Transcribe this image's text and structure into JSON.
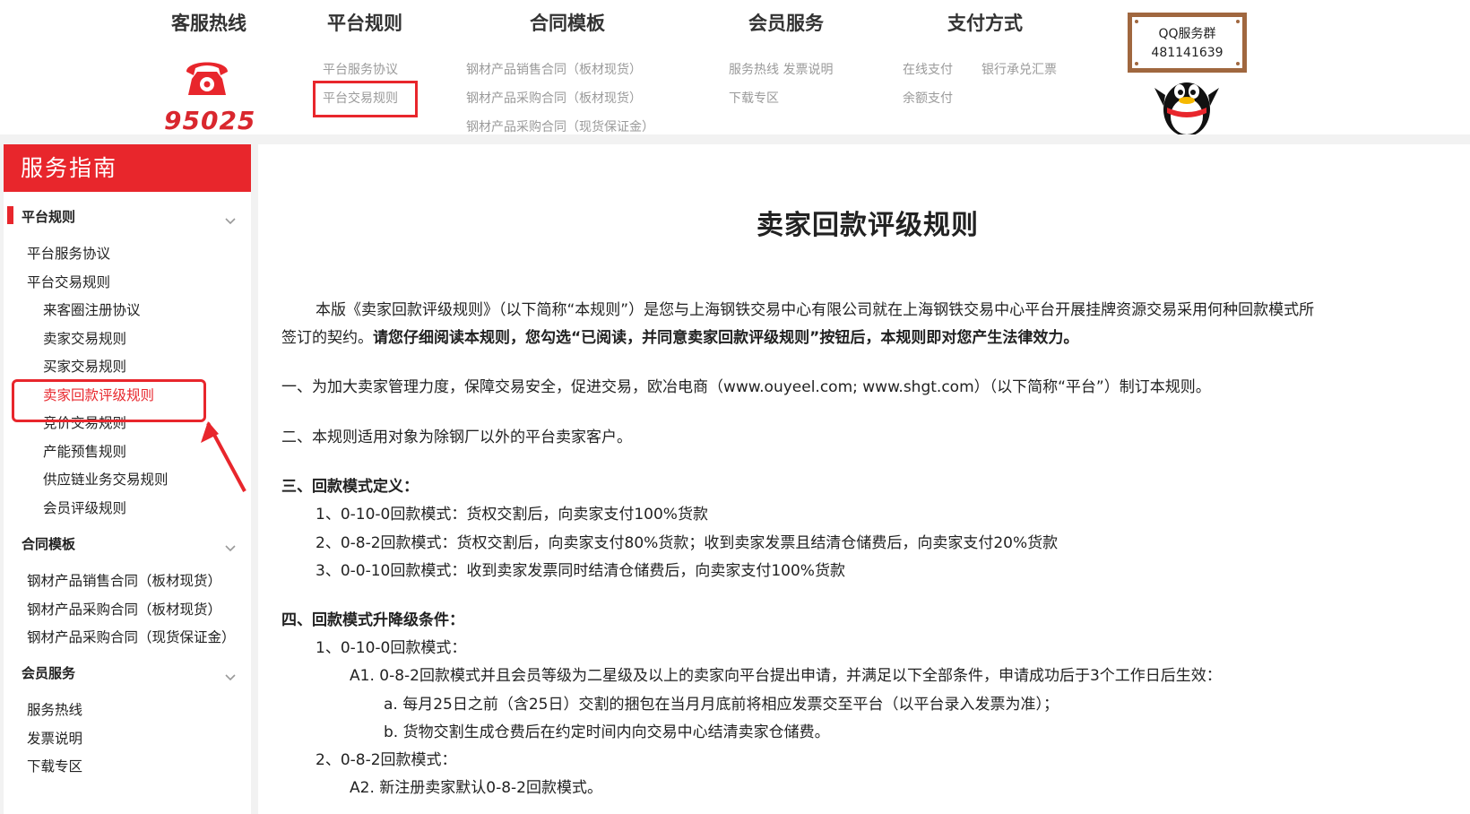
{
  "top_nav": {
    "hotline": {
      "title": "客服热线",
      "number": "95025"
    },
    "platform_rules": {
      "title": "平台规则",
      "links": [
        "平台服务协议",
        "平台交易规则"
      ]
    },
    "contract_templates": {
      "title": "合同模板",
      "links": [
        "钢材产品销售合同（板材现货）",
        "钢材产品采购合同（板材现货）",
        "钢材产品采购合同（现货保证金）"
      ]
    },
    "member_service": {
      "title": "会员服务",
      "links": [
        "服务热线 发票说明",
        "下载专区"
      ]
    },
    "payment": {
      "title": "支付方式",
      "links": [
        "在线支付",
        "银行承兑汇票",
        "余额支付"
      ]
    },
    "qq_group": {
      "label": "QQ服务群",
      "number": "481141639"
    }
  },
  "sidebar": {
    "header": "服务指南",
    "sections": [
      {
        "title": "平台规则",
        "items": [
          "平台服务协议",
          "平台交易规则"
        ],
        "sub_items": [
          "来客圈注册协议",
          "卖家交易规则",
          "买家交易规则",
          "卖家回款评级规则",
          "竞价交易规则",
          "产能预售规则",
          "供应链业务交易规则",
          "会员评级规则"
        ],
        "active": "卖家回款评级规则"
      },
      {
        "title": "合同模板",
        "items": [
          "钢材产品销售合同（板材现货）",
          "钢材产品采购合同（板材现货）",
          "钢材产品采购合同（现货保证金）"
        ]
      },
      {
        "title": "会员服务",
        "items": [
          "服务热线",
          "发票说明",
          "下载专区"
        ]
      }
    ]
  },
  "document": {
    "title": "卖家回款评级规则",
    "intro_line1": "本版《卖家回款评级规则》（以下简称“本规则”）是您与上海钢铁交易中心有限公司就在上海钢铁交易中心平台开展挂牌资源交易采用何种回款模式所",
    "intro_line2_plain": "签订的契约。",
    "intro_line2_bold": "请您仔细阅读本规则，您勾选“已阅读，并同意卖家回款评级规则”按钮后，本规则即对您产生法律效力。",
    "item1": "一、为加大卖家管理力度，保障交易安全，促进交易，欧冶电商（www.ouyeel.com; www.shgt.com）（以下简称“平台”）制订本规则。",
    "item2": "二、本规则适用对象为除钢厂以外的平台卖家客户。",
    "item3_title": "三、回款模式定义：",
    "item3_lines": [
      "1、0-10-0回款模式：货权交割后，向卖家支付100%货款",
      "2、0-8-2回款模式：货权交割后，向卖家支付80%货款；收到卖家发票且结清仓储费后，向卖家支付20%货款",
      "3、0-0-10回款模式：收到卖家发票同时结清仓储费后，向卖家支付100%货款"
    ],
    "item4_title": "四、回款模式升降级条件：",
    "item4_l1": "1、0-10-0回款模式：",
    "item4_a1": "A1. 0-8-2回款模式并且会员等级为二星级及以上的卖家向平台提出申请，并满足以下全部条件，申请成功后于3个工作日后生效：",
    "item4_a1_a": "a. 每月25日之前（含25日）交割的捆包在当月月底前将相应发票交至平台（以平台录入发票为准）；",
    "item4_a1_b": "b. 货物交割生成仓费后在约定时间内向交易中心结清卖家仓储费。",
    "item4_l2": "2、0-8-2回款模式：",
    "item4_a2": "A2. 新注册卖家默认0-8-2回款模式。"
  },
  "colors": {
    "accent": "#e8262c",
    "sign_border": "#a0673f"
  }
}
